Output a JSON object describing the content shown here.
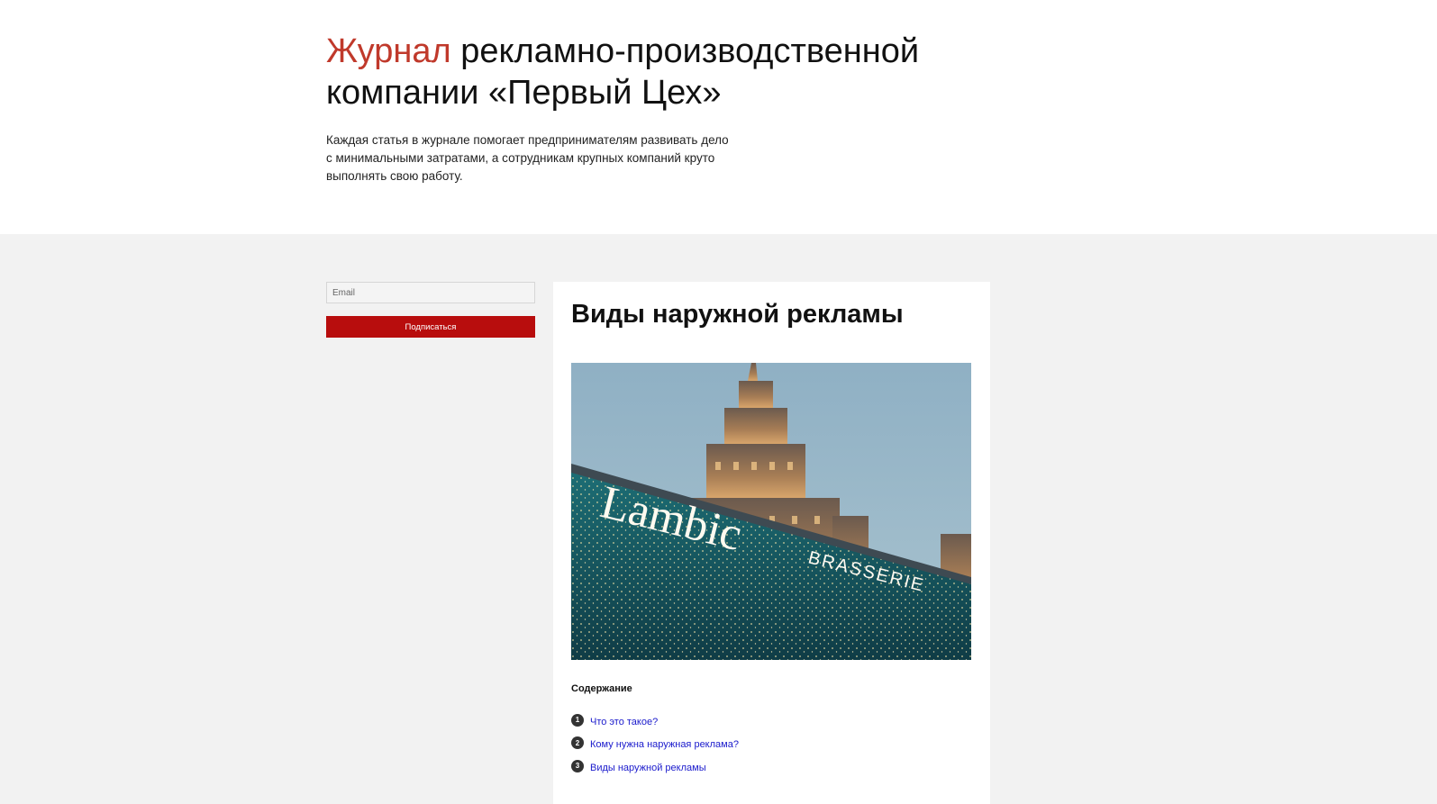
{
  "header": {
    "title_accent": "Журнал",
    "title_rest_line1": " рекламно-производственной",
    "title_rest_line2": "компании «Первый Цех»",
    "intro_line1": "Каждая статья в журнале помогает предпринимателям развивать дело",
    "intro_line2": "с минимальными затратами, а сотрудникам крупных компаний круто",
    "intro_line3": "выполнять свою работу."
  },
  "subscribe": {
    "email_placeholder": "Email",
    "button_label": "Подписаться"
  },
  "article": {
    "title": "Виды наружной рекламы",
    "image_sign_main": "Lambic",
    "image_sign_sub": "BRASSERIE",
    "toc_title": "Содержание",
    "toc": [
      {
        "num": "1",
        "label": "Что это такое?"
      },
      {
        "num": "2",
        "label": "Кому нужна наружная реклама?"
      },
      {
        "num": "3",
        "label": "Виды наружной рекламы"
      }
    ]
  },
  "colors": {
    "accent": "#c0392b",
    "button": "#b80d0d",
    "link": "#1a1acc",
    "background": "#f2f2f2"
  }
}
